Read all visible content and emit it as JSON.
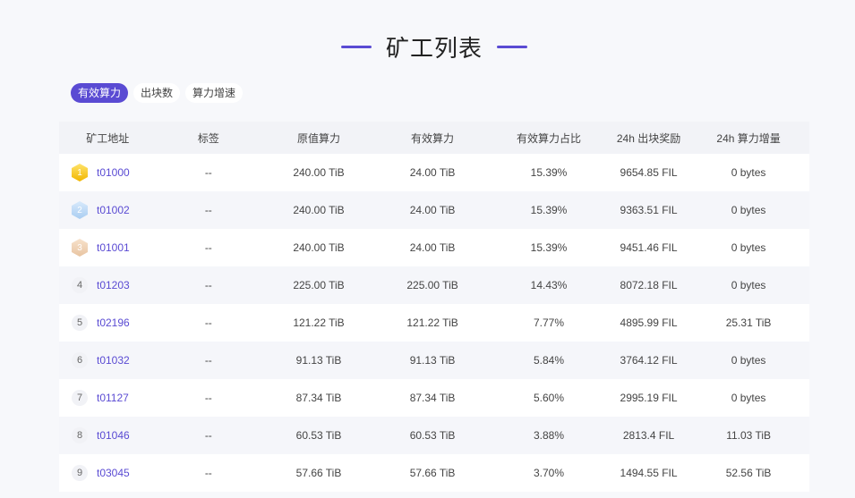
{
  "page": {
    "title": "矿工列表"
  },
  "tabs": [
    {
      "label": "有效算力",
      "active": true
    },
    {
      "label": "出块数",
      "active": false
    },
    {
      "label": "算力增速",
      "active": false
    }
  ],
  "table": {
    "headers": [
      "矿工地址",
      "标签",
      "原值算力",
      "有效算力",
      "有效算力占比",
      "24h 出块奖励",
      "24h 算力增量"
    ],
    "rows": [
      {
        "rank": "1",
        "address": "t01000",
        "tag": "--",
        "raw": "240.00 TiB",
        "effective": "24.00 TiB",
        "ratio": "15.39%",
        "reward": "9654.85 FIL",
        "growth": "0 bytes"
      },
      {
        "rank": "2",
        "address": "t01002",
        "tag": "--",
        "raw": "240.00 TiB",
        "effective": "24.00 TiB",
        "ratio": "15.39%",
        "reward": "9363.51 FIL",
        "growth": "0 bytes"
      },
      {
        "rank": "3",
        "address": "t01001",
        "tag": "--",
        "raw": "240.00 TiB",
        "effective": "24.00 TiB",
        "ratio": "15.39%",
        "reward": "9451.46 FIL",
        "growth": "0 bytes"
      },
      {
        "rank": "4",
        "address": "t01203",
        "tag": "--",
        "raw": "225.00 TiB",
        "effective": "225.00 TiB",
        "ratio": "14.43%",
        "reward": "8072.18 FIL",
        "growth": "0 bytes"
      },
      {
        "rank": "5",
        "address": "t02196",
        "tag": "--",
        "raw": "121.22 TiB",
        "effective": "121.22 TiB",
        "ratio": "7.77%",
        "reward": "4895.99 FIL",
        "growth": "25.31 TiB"
      },
      {
        "rank": "6",
        "address": "t01032",
        "tag": "--",
        "raw": "91.13 TiB",
        "effective": "91.13 TiB",
        "ratio": "5.84%",
        "reward": "3764.12 FIL",
        "growth": "0 bytes"
      },
      {
        "rank": "7",
        "address": "t01127",
        "tag": "--",
        "raw": "87.34 TiB",
        "effective": "87.34 TiB",
        "ratio": "5.60%",
        "reward": "2995.19 FIL",
        "growth": "0 bytes"
      },
      {
        "rank": "8",
        "address": "t01046",
        "tag": "--",
        "raw": "60.53 TiB",
        "effective": "60.53 TiB",
        "ratio": "3.88%",
        "reward": "2813.4 FIL",
        "growth": "11.03 TiB"
      },
      {
        "rank": "9",
        "address": "t03045",
        "tag": "--",
        "raw": "57.66 TiB",
        "effective": "57.66 TiB",
        "ratio": "3.70%",
        "reward": "1494.55 FIL",
        "growth": "52.56 TiB"
      }
    ]
  },
  "colors": {
    "accent": "#5a4bd3",
    "gold": "#f1b600",
    "silver": "#a9cdf1",
    "bronze": "#e8c4a1"
  }
}
